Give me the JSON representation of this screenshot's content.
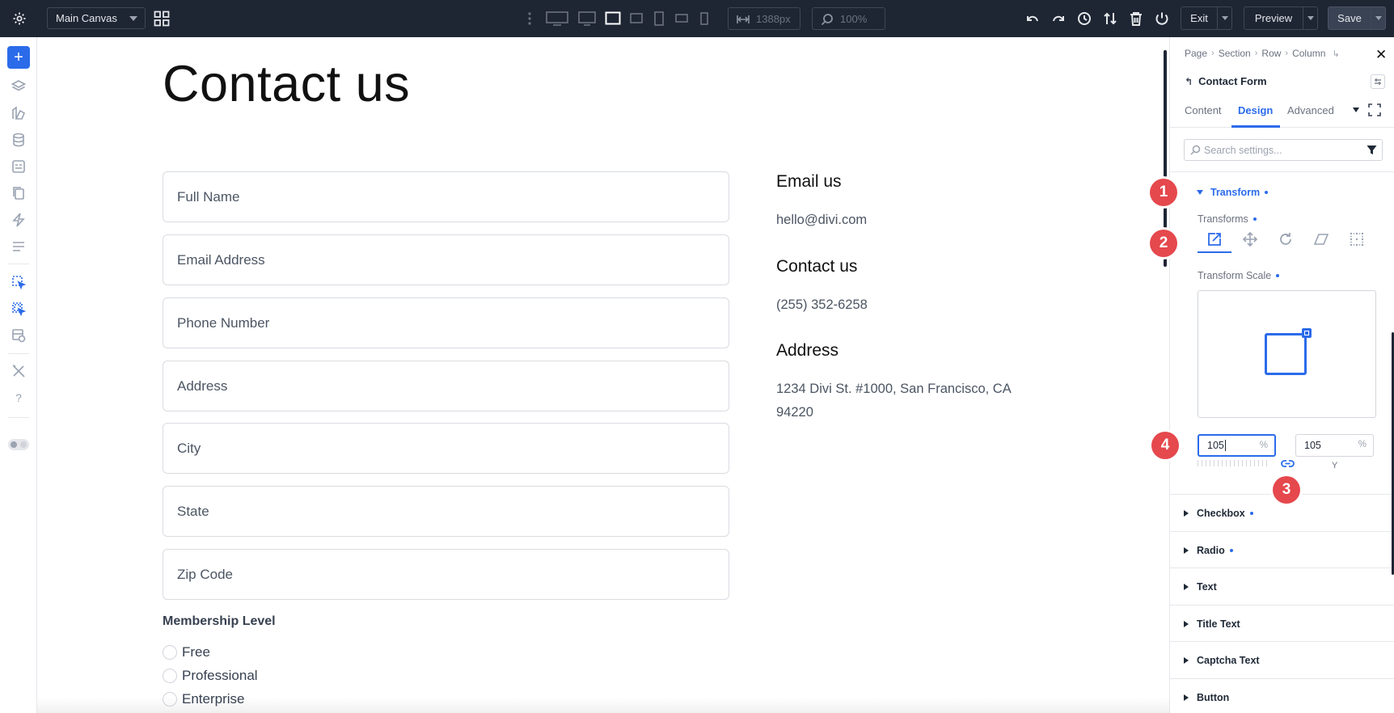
{
  "topbar": {
    "canvas_select": "Main Canvas",
    "width_value": "1388px",
    "zoom_value": "100%",
    "exit_label": "Exit",
    "preview_label": "Preview",
    "save_label": "Save"
  },
  "canvas": {
    "page_title": "Contact us",
    "form_fields": [
      "Full Name",
      "Email Address",
      "Phone Number",
      "Address",
      "City",
      "State",
      "Zip Code"
    ],
    "membership_label": "Membership Level",
    "membership_options": [
      "Free",
      "Professional",
      "Enterprise"
    ],
    "info": {
      "email_heading": "Email us",
      "email_value": "hello@divi.com",
      "contact_heading": "Contact us",
      "contact_value": "(255) 352-6258",
      "address_heading": "Address",
      "address_line1": "1234 Divi St. #1000, San Francisco, CA",
      "address_line2": "94220"
    }
  },
  "panel": {
    "breadcrumbs": [
      "Page",
      "Section",
      "Row",
      "Column"
    ],
    "module_name": "Contact Form",
    "tabs": [
      "Content",
      "Design",
      "Advanced"
    ],
    "active_tab": "Design",
    "search_placeholder": "Search settings...",
    "section_title": "Transform",
    "transforms_label": "Transforms",
    "scale_label": "Transform Scale",
    "scale_x": "105",
    "scale_y": "105",
    "unit": "%",
    "y_label": "Y",
    "accordions": [
      "Checkbox",
      "Radio",
      "Text",
      "Title Text",
      "Captcha Text",
      "Button"
    ],
    "accordions_with_dot": [
      "Checkbox",
      "Radio"
    ]
  },
  "badges": [
    "1",
    "2",
    "3",
    "4"
  ],
  "colors": {
    "accent": "#2b6bea",
    "badge": "#e5484d",
    "topbar": "#1e2533"
  }
}
